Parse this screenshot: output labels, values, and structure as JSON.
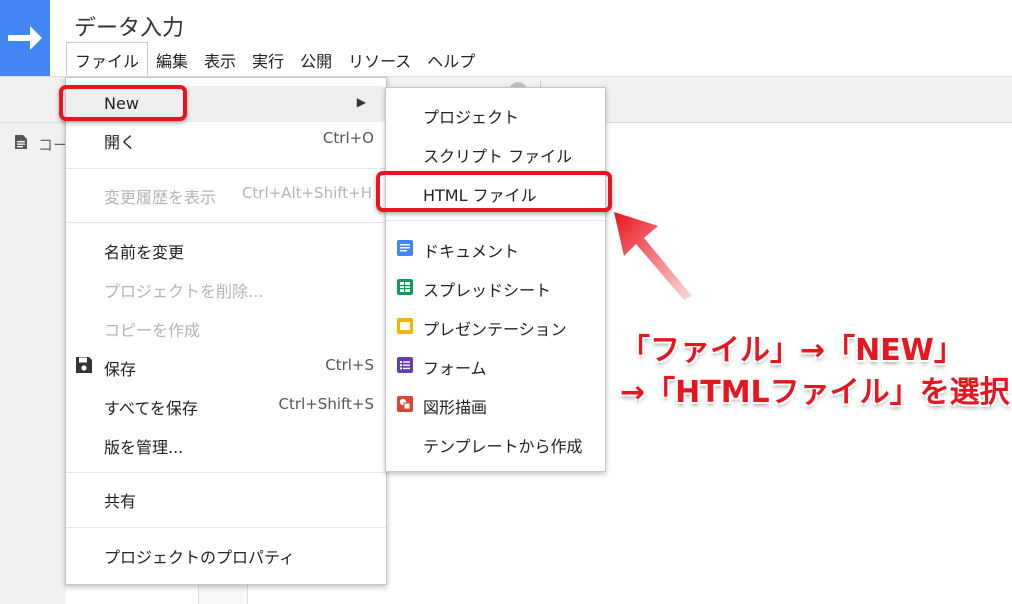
{
  "header": {
    "title": "データ入力",
    "menus": [
      "ファイル",
      "編集",
      "表示",
      "実行",
      "公開",
      "リソース",
      "ヘルプ"
    ]
  },
  "left_panel": {
    "file_label": "コー"
  },
  "file_menu": {
    "items": [
      {
        "label": "New",
        "shortcut": "",
        "has_submenu": true,
        "highlighted": true,
        "disabled": false
      },
      {
        "label": "開く",
        "shortcut": "Ctrl+O",
        "disabled": false
      },
      {
        "label": "変更履歴を表示",
        "shortcut": "Ctrl+Alt+Shift+H",
        "disabled": true
      },
      {
        "label": "名前を変更",
        "shortcut": "",
        "disabled": false
      },
      {
        "label": "プロジェクトを削除...",
        "shortcut": "",
        "disabled": true
      },
      {
        "label": "コピーを作成",
        "shortcut": "",
        "disabled": true
      },
      {
        "label": "保存",
        "shortcut": "Ctrl+S",
        "icon": "save-icon",
        "disabled": false
      },
      {
        "label": "すべてを保存",
        "shortcut": "Ctrl+Shift+S",
        "disabled": false
      },
      {
        "label": "版を管理...",
        "shortcut": "",
        "disabled": false
      },
      {
        "label": "共有",
        "shortcut": "",
        "disabled": false
      },
      {
        "label": "プロジェクトのプロパティ",
        "shortcut": "",
        "disabled": false
      }
    ]
  },
  "new_submenu": {
    "items": [
      {
        "label": "プロジェクト",
        "icon": ""
      },
      {
        "label": "スクリプト ファイル",
        "icon": ""
      },
      {
        "label": "HTML ファイル",
        "icon": ""
      },
      {
        "label": "ドキュメント",
        "icon": "docs-icon",
        "color": "#4285f4"
      },
      {
        "label": "スプレッドシート",
        "icon": "sheets-icon",
        "color": "#0f9d58"
      },
      {
        "label": "プレゼンテーション",
        "icon": "slides-icon",
        "color": "#f4b400"
      },
      {
        "label": "フォーム",
        "icon": "forms-icon",
        "color": "#673ab7"
      },
      {
        "label": "図形描画",
        "icon": "drawings-icon",
        "color": "#db4437"
      },
      {
        "label": "テンプレートから作成",
        "icon": ""
      }
    ]
  },
  "annotation": {
    "line1": "「ファイル」→「NEW」",
    "line2": "→「HTMLファイル」を選択",
    "color": "#e8141e"
  }
}
